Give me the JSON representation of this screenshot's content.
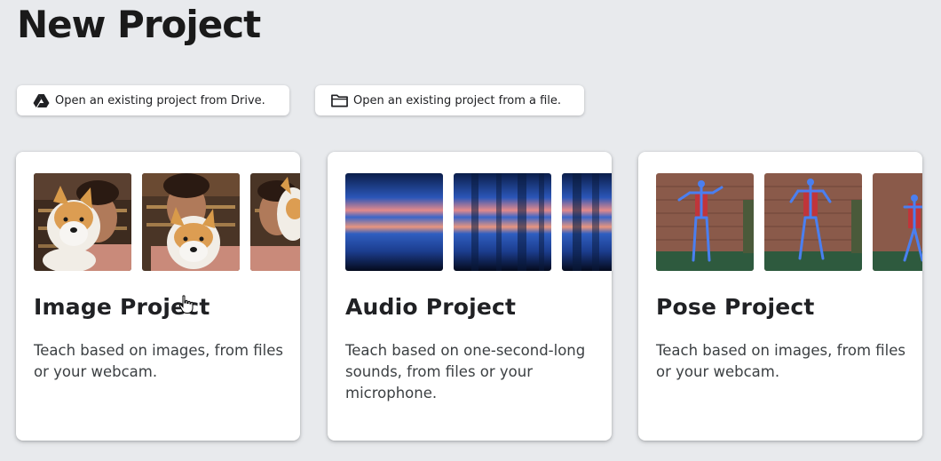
{
  "page": {
    "title": "New Project"
  },
  "open_drive": {
    "label": "Open an existing project from Drive.",
    "icon": "google-drive-icon"
  },
  "open_file": {
    "label": "Open an existing project from a file.",
    "icon": "folder-icon"
  },
  "cards": [
    {
      "title": "Image Project",
      "description": "Teach based on images, from files or your webcam."
    },
    {
      "title": "Audio Project",
      "description": "Teach based on one-second-long sounds, from files or your microphone."
    },
    {
      "title": "Pose Project",
      "description": "Teach based on images, from files or your webcam."
    }
  ],
  "colors": {
    "background": "#e8eaed",
    "card": "#ffffff",
    "text": "#202124"
  }
}
